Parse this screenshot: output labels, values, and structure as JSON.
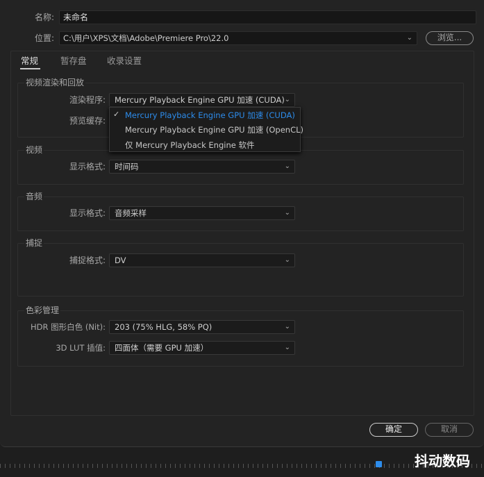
{
  "project": {
    "name_label": "名称:",
    "name_value": "未命名",
    "location_label": "位置:",
    "location_value": "C:\\用户\\XPS\\文档\\Adobe\\Premiere Pro\\22.0",
    "browse_label": "浏览..."
  },
  "tabs": [
    {
      "label": "常规",
      "active": true
    },
    {
      "label": "暂存盘"
    },
    {
      "label": "收录设置"
    }
  ],
  "groups": {
    "render": {
      "title": "视频渲染和回放",
      "renderer_label": "渲染程序:",
      "renderer_value": "Mercury Playback Engine GPU 加速 (CUDA)",
      "preview_label": "预览缓存:"
    },
    "video": {
      "title": "视频",
      "format_label": "显示格式:",
      "format_value": "时间码"
    },
    "audio": {
      "title": "音频",
      "format_label": "显示格式:",
      "format_value": "音频采样"
    },
    "capture": {
      "title": "捕捉",
      "format_label": "捕捉格式:",
      "format_value": "DV"
    },
    "color": {
      "title": "色彩管理",
      "hdr_label": "HDR 图形白色 (Nit):",
      "hdr_value": "203 (75% HLG, 58% PQ)",
      "lut_label": "3D LUT 插值:",
      "lut_value": "四面体（需要 GPU 加速）"
    }
  },
  "renderer_menu": {
    "items": [
      "Mercury Playback Engine GPU 加速 (CUDA)",
      "Mercury Playback Engine GPU 加速 (OpenCL)",
      "仅 Mercury Playback Engine 软件"
    ],
    "selected": 0,
    "check": "✓"
  },
  "buttons": {
    "ok": "确定",
    "cancel": "取消"
  },
  "watermark": "抖动数码",
  "colors": {
    "accent": "#2d8ceb",
    "background": "#232323"
  }
}
